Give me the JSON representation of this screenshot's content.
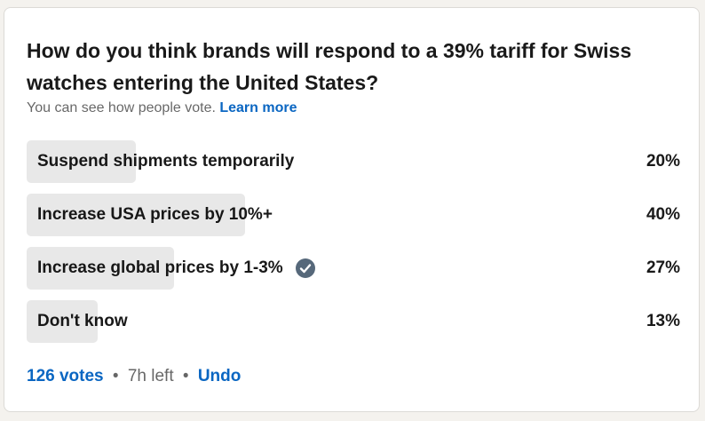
{
  "poll": {
    "question": "How do you think brands will respond to a 39% tariff for Swiss watches entering the United States?",
    "visibility_text": "You can see how people vote.",
    "learn_more": "Learn more",
    "options": [
      {
        "label": "Suspend shipments temporarily",
        "percent": "20%",
        "value": 20,
        "selected": false
      },
      {
        "label": "Increase USA prices by 10%+",
        "percent": "40%",
        "value": 40,
        "selected": false
      },
      {
        "label": "Increase global prices by 1-3%",
        "percent": "27%",
        "value": 27,
        "selected": true
      },
      {
        "label": "Don't know",
        "percent": "13%",
        "value": 13,
        "selected": false
      }
    ],
    "votes": "126 votes",
    "time_left": "7h left",
    "undo": "Undo",
    "selected_icon": "check-circle-icon"
  },
  "colors": {
    "accent": "#0a66c2",
    "bar": "#e8e8e8",
    "check": "#56687a"
  }
}
